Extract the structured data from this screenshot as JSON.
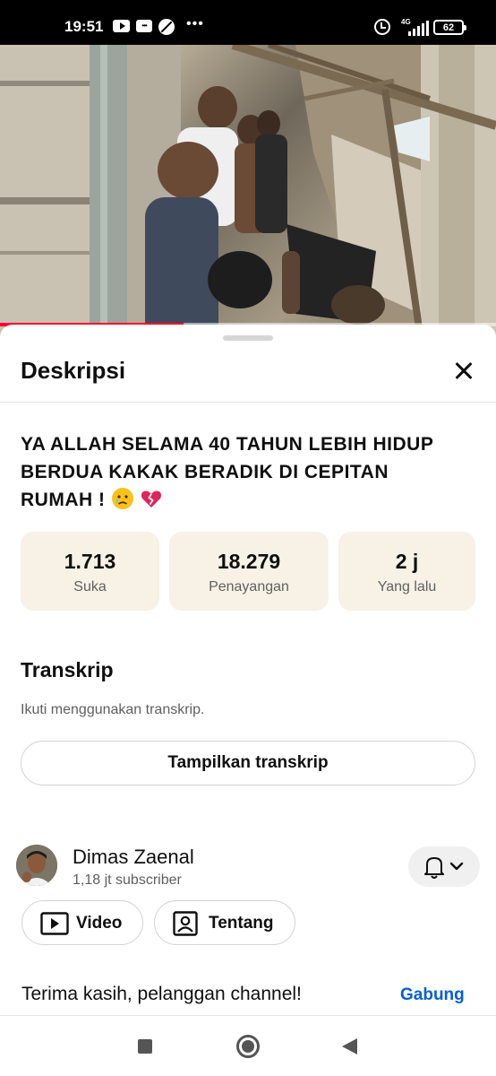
{
  "status_bar": {
    "time": "19:51",
    "network": "4G",
    "battery": "62",
    "icons": [
      "youtube-icon",
      "message-icon",
      "do-not-disturb-icon",
      "more-icon",
      "alarm-icon",
      "signal-icon",
      "battery-icon"
    ]
  },
  "video": {
    "progress": 0.37,
    "progress_color": "#ff0033"
  },
  "sheet": {
    "title": "Deskripsi",
    "video_title_text": "YA ALLAH SELAMA 40 TAHUN LEBIH HIDUP BERDUA KAKAK BERADIK DI CEPITAN RUMAH ! ",
    "video_title_emojis": [
      "crying-face-emoji",
      "broken-heart-emoji"
    ],
    "stats": [
      {
        "value": "1.713",
        "label": "Suka"
      },
      {
        "value": "18.279",
        "label": "Penayangan"
      },
      {
        "value": "2 j",
        "label": "Yang lalu"
      }
    ],
    "stat_bg": "#f7f1e6"
  },
  "transcript": {
    "title": "Transkrip",
    "subtitle": "Ikuti menggunakan transkrip.",
    "button_label": "Tampilkan transkrip"
  },
  "channel": {
    "name": "Dimas Zaenal",
    "subscribers": "1,18 jt subscriber",
    "video_label": "Video",
    "about_label": "Tentang"
  },
  "membership": {
    "text": "Terima kasih, pelanggan channel!",
    "join_label": "Gabung",
    "join_color": "#065fd4"
  },
  "nav": {
    "icons": [
      "recents-square-icon",
      "home-circle-icon",
      "back-triangle-icon"
    ]
  }
}
